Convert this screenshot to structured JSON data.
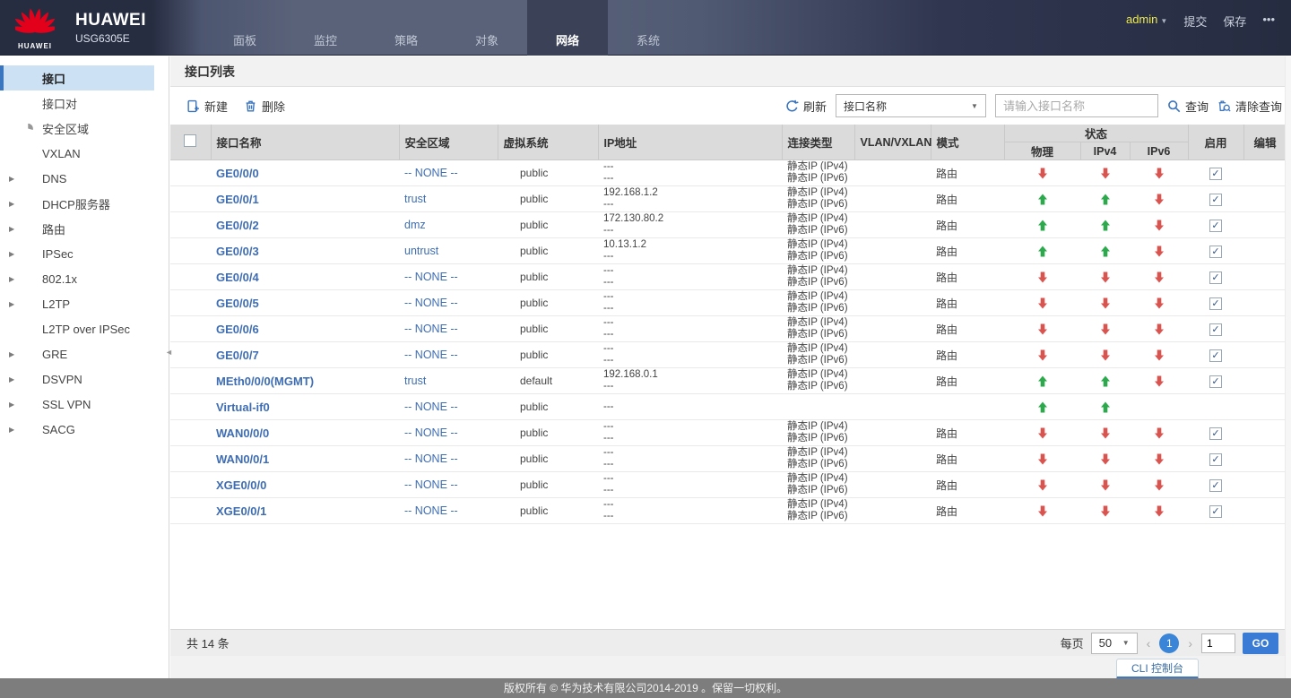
{
  "colors": {
    "accent": "#3a74bc",
    "link": "#3e6db3",
    "up_green": "#2ca94c",
    "down_red": "#d9534f"
  },
  "header": {
    "brand": {
      "name": "HUAWEI",
      "model": "USG6305E",
      "logo_word": "HUAWEI"
    },
    "tabs": [
      {
        "id": "dashboard",
        "icon": "dashboard",
        "label": "面板",
        "active": false
      },
      {
        "id": "monitor",
        "icon": "monitor",
        "label": "监控",
        "active": false
      },
      {
        "id": "policy",
        "icon": "policy",
        "label": "策略",
        "active": false
      },
      {
        "id": "object",
        "icon": "object",
        "label": "对象",
        "active": false
      },
      {
        "id": "network",
        "icon": "network",
        "label": "网络",
        "active": true
      },
      {
        "id": "system",
        "icon": "system",
        "label": "系统",
        "active": false
      }
    ],
    "user": {
      "name": "admin"
    },
    "submit_label": "提交",
    "save_label": "保存",
    "more_label": "•••"
  },
  "sidebar": {
    "items": [
      {
        "id": "interface",
        "icon": "interface",
        "label": "接口",
        "selected": true,
        "expandable": false
      },
      {
        "id": "interface-pair",
        "icon": "interface-pair",
        "label": "接口对",
        "selected": false,
        "expandable": false
      },
      {
        "id": "security-zone",
        "icon": "zone",
        "label": "安全区域",
        "selected": false,
        "expandable": false
      },
      {
        "id": "vxlan",
        "icon": "vxlan",
        "label": "VXLAN",
        "selected": false,
        "expandable": false
      },
      {
        "id": "dns",
        "icon": "dns",
        "label": "DNS",
        "selected": false,
        "expandable": true
      },
      {
        "id": "dhcp-server",
        "icon": "dhcp",
        "label": "DHCP服务器",
        "selected": false,
        "expandable": true
      },
      {
        "id": "route",
        "icon": "route",
        "label": "路由",
        "selected": false,
        "expandable": true
      },
      {
        "id": "ipsec",
        "icon": "ipsec",
        "label": "IPSec",
        "selected": false,
        "expandable": true
      },
      {
        "id": "dot1x",
        "icon": "dot1x",
        "label": "802.1x",
        "selected": false,
        "expandable": true
      },
      {
        "id": "l2tp",
        "icon": "l2tp",
        "label": "L2TP",
        "selected": false,
        "expandable": true
      },
      {
        "id": "l2tp-over-ipsec",
        "icon": "l2tp-ipsec",
        "label": "L2TP over IPSec",
        "selected": false,
        "expandable": false
      },
      {
        "id": "gre",
        "icon": "gre",
        "label": "GRE",
        "selected": false,
        "expandable": true
      },
      {
        "id": "dsvpn",
        "icon": "dsvpn",
        "label": "DSVPN",
        "selected": false,
        "expandable": true
      },
      {
        "id": "ssl-vpn",
        "icon": "sslvpn",
        "label": "SSL VPN",
        "selected": false,
        "expandable": true
      },
      {
        "id": "sacg",
        "icon": "sacg",
        "label": "SACG",
        "selected": false,
        "expandable": true
      }
    ]
  },
  "main": {
    "title": "接口列表",
    "toolbar": {
      "new_label": "新建",
      "delete_label": "删除",
      "refresh_label": "刷新",
      "filter_selected": "接口名称",
      "search_placeholder": "请输入接口名称",
      "query_label": "查询",
      "clear_query_label": "清除查询"
    },
    "table": {
      "columns": [
        "接口名称",
        "安全区域",
        "虚拟系统",
        "IP地址",
        "连接类型",
        "VLAN/VXLAN",
        "模式",
        "状态",
        "启用",
        "编辑"
      ],
      "status_subcolumns": [
        "物理",
        "IPv4",
        "IPv6"
      ],
      "rows": [
        {
          "name": "GE0/0/0",
          "zone": "-- NONE --",
          "vsys": "public",
          "vsys_icon": "vsys-public",
          "ip": [
            "---",
            "---"
          ],
          "conn": [
            "静态IP (IPv4)",
            "静态IP (IPv6)"
          ],
          "vlan": "",
          "mode": "路由",
          "phy": "down",
          "ipv4": "down",
          "ipv6": "down",
          "enabled": true,
          "editable": true
        },
        {
          "name": "GE0/0/1",
          "zone": "trust",
          "vsys": "public",
          "vsys_icon": "vsys-public",
          "ip": [
            "192.168.1.2",
            "---"
          ],
          "conn": [
            "静态IP (IPv4)",
            "静态IP (IPv6)"
          ],
          "vlan": "",
          "mode": "路由",
          "phy": "up",
          "ipv4": "up",
          "ipv6": "down",
          "enabled": true,
          "editable": true
        },
        {
          "name": "GE0/0/2",
          "zone": "dmz",
          "vsys": "public",
          "vsys_icon": "vsys-public",
          "ip": [
            "172.130.80.2",
            "---"
          ],
          "conn": [
            "静态IP (IPv4)",
            "静态IP (IPv6)"
          ],
          "vlan": "",
          "mode": "路由",
          "phy": "up",
          "ipv4": "up",
          "ipv6": "down",
          "enabled": true,
          "editable": true
        },
        {
          "name": "GE0/0/3",
          "zone": "untrust",
          "vsys": "public",
          "vsys_icon": "vsys-public",
          "ip": [
            "10.13.1.2",
            "---"
          ],
          "conn": [
            "静态IP (IPv4)",
            "静态IP (IPv6)"
          ],
          "vlan": "",
          "mode": "路由",
          "phy": "up",
          "ipv4": "up",
          "ipv6": "down",
          "enabled": true,
          "editable": true
        },
        {
          "name": "GE0/0/4",
          "zone": "-- NONE --",
          "vsys": "public",
          "vsys_icon": "vsys-public",
          "ip": [
            "---",
            "---"
          ],
          "conn": [
            "静态IP (IPv4)",
            "静态IP (IPv6)"
          ],
          "vlan": "",
          "mode": "路由",
          "phy": "down",
          "ipv4": "down",
          "ipv6": "down",
          "enabled": true,
          "editable": true
        },
        {
          "name": "GE0/0/5",
          "zone": "-- NONE --",
          "vsys": "public",
          "vsys_icon": "vsys-public",
          "ip": [
            "---",
            "---"
          ],
          "conn": [
            "静态IP (IPv4)",
            "静态IP (IPv6)"
          ],
          "vlan": "",
          "mode": "路由",
          "phy": "down",
          "ipv4": "down",
          "ipv6": "down",
          "enabled": true,
          "editable": true
        },
        {
          "name": "GE0/0/6",
          "zone": "-- NONE --",
          "vsys": "public",
          "vsys_icon": "vsys-public",
          "ip": [
            "---",
            "---"
          ],
          "conn": [
            "静态IP (IPv4)",
            "静态IP (IPv6)"
          ],
          "vlan": "",
          "mode": "路由",
          "phy": "down",
          "ipv4": "down",
          "ipv6": "down",
          "enabled": true,
          "editable": true
        },
        {
          "name": "GE0/0/7",
          "zone": "-- NONE --",
          "vsys": "public",
          "vsys_icon": "vsys-public",
          "ip": [
            "---",
            "---"
          ],
          "conn": [
            "静态IP (IPv4)",
            "静态IP (IPv6)"
          ],
          "vlan": "",
          "mode": "路由",
          "phy": "down",
          "ipv4": "down",
          "ipv6": "down",
          "enabled": true,
          "editable": true
        },
        {
          "name": "MEth0/0/0(MGMT)",
          "zone": "trust",
          "vsys": "default",
          "vsys_icon": "vsys-default",
          "ip": [
            "192.168.0.1",
            "---"
          ],
          "conn": [
            "静态IP (IPv4)",
            "静态IP (IPv6)"
          ],
          "vlan": "",
          "mode": "路由",
          "phy": "up",
          "ipv4": "up",
          "ipv6": "down",
          "enabled": true,
          "editable": true
        },
        {
          "name": "Virtual-if0",
          "zone": "-- NONE --",
          "vsys": "public",
          "vsys_icon": "vsys-public",
          "ip": [
            "---"
          ],
          "conn": [],
          "vlan": "",
          "mode": "",
          "phy": "up",
          "ipv4": "up",
          "ipv6": "",
          "enabled": null,
          "editable": true
        },
        {
          "name": "WAN0/0/0",
          "zone": "-- NONE --",
          "vsys": "public",
          "vsys_icon": "vsys-public",
          "ip": [
            "---",
            "---"
          ],
          "conn": [
            "静态IP (IPv4)",
            "静态IP (IPv6)"
          ],
          "vlan": "",
          "mode": "路由",
          "phy": "down",
          "ipv4": "down",
          "ipv6": "down",
          "enabled": true,
          "editable": true
        },
        {
          "name": "WAN0/0/1",
          "zone": "-- NONE --",
          "vsys": "public",
          "vsys_icon": "vsys-public",
          "ip": [
            "---",
            "---"
          ],
          "conn": [
            "静态IP (IPv4)",
            "静态IP (IPv6)"
          ],
          "vlan": "",
          "mode": "路由",
          "phy": "down",
          "ipv4": "down",
          "ipv6": "down",
          "enabled": true,
          "editable": true
        },
        {
          "name": "XGE0/0/0",
          "zone": "-- NONE --",
          "vsys": "public",
          "vsys_icon": "vsys-public",
          "ip": [
            "---",
            "---"
          ],
          "conn": [
            "静态IP (IPv4)",
            "静态IP (IPv6)"
          ],
          "vlan": "",
          "mode": "路由",
          "phy": "down",
          "ipv4": "down",
          "ipv6": "down",
          "enabled": true,
          "editable": true
        },
        {
          "name": "XGE0/0/1",
          "zone": "-- NONE --",
          "vsys": "public",
          "vsys_icon": "vsys-public",
          "ip": [
            "---",
            "---"
          ],
          "conn": [
            "静态IP (IPv4)",
            "静态IP (IPv6)"
          ],
          "vlan": "",
          "mode": "路由",
          "phy": "down",
          "ipv4": "down",
          "ipv6": "down",
          "enabled": true,
          "editable": true
        }
      ]
    },
    "pagination": {
      "total_label": "共 14 条",
      "per_page_label": "每页",
      "per_page_value": "50",
      "page_current": "1",
      "goto_value": "1",
      "go_label": "GO"
    }
  },
  "footer": {
    "cli_label": "CLI 控制台",
    "copyright": "版权所有 © 华为技术有限公司2014-2019 。保留一切权利。"
  }
}
